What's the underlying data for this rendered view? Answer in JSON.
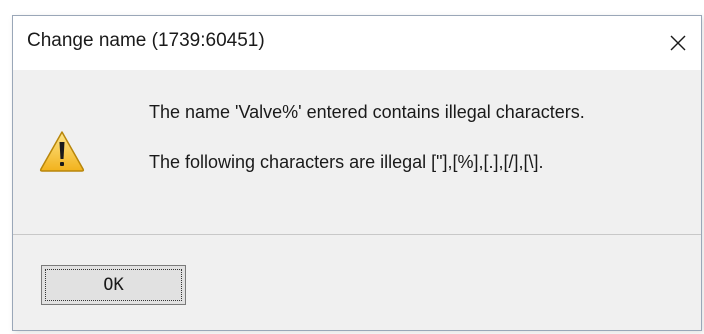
{
  "dialog": {
    "title": "Change name  (1739:60451)",
    "message_line1": "The name 'Valve%' entered contains illegal characters.",
    "message_line2": "The following characters are illegal [\"],[%],[.],[/],[\\].",
    "ok_label": "OK",
    "icon": "warning-icon",
    "close_icon": "close-icon"
  },
  "colors": {
    "dialog_background": "#f0f0f0",
    "titlebar_background": "#ffffff",
    "warning_fill": "#f7c02e",
    "warning_outline": "#b8860b"
  }
}
